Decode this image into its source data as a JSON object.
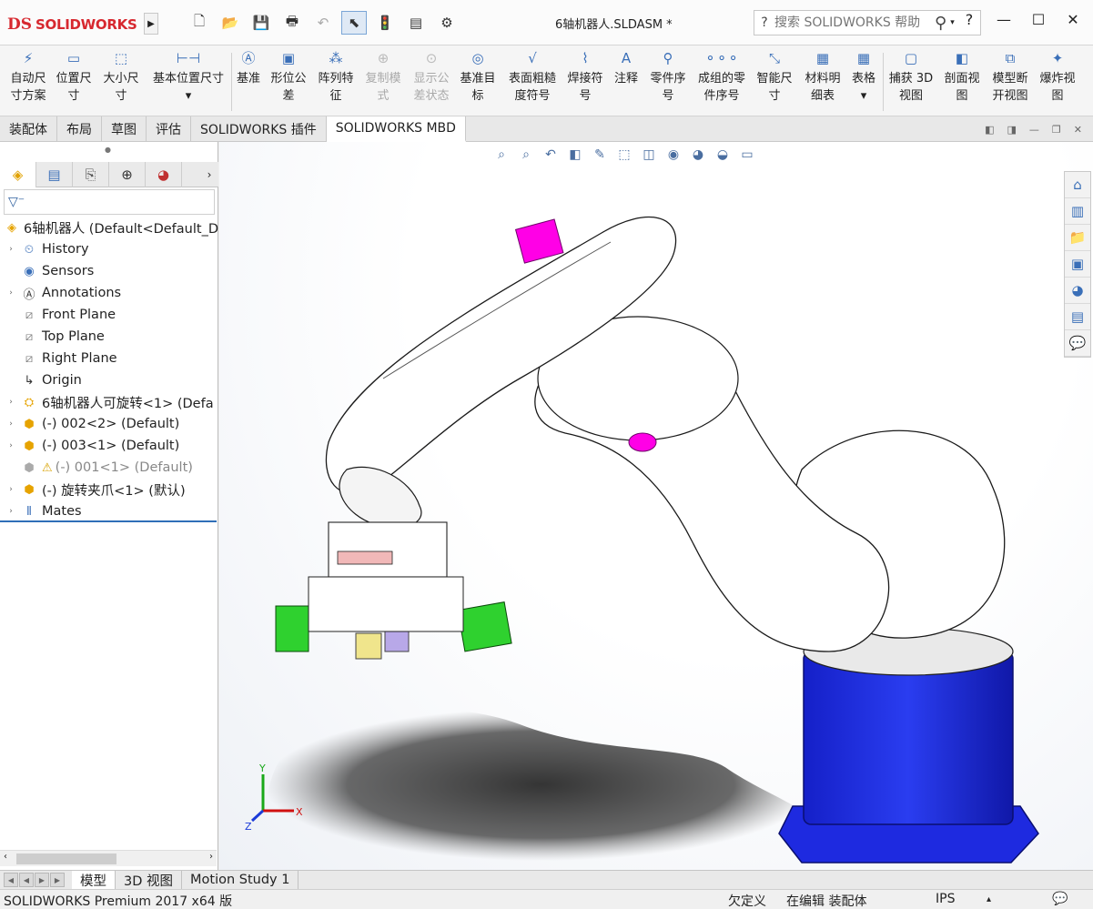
{
  "app": {
    "logo_ds": "DS",
    "logo_text": "SOLIDWORKS",
    "doc_title": "6轴机器人.SLDASM *",
    "search_placeholder": "搜索 SOLIDWORKS 帮助",
    "help_glyph": "?",
    "accent": "#d7282f"
  },
  "ribbon": {
    "buttons": [
      {
        "l1": "自动尺",
        "l2": "寸方案",
        "icon": "auto-dimension-icon"
      },
      {
        "l1": "位置尺",
        "l2": "寸",
        "icon": "location-dimension-icon"
      },
      {
        "l1": "大小尺",
        "l2": "寸",
        "icon": "size-dimension-icon"
      },
      {
        "l1": "基本位置尺寸",
        "l2": "",
        "icon": "basic-location-icon"
      },
      {
        "l1": "基准",
        "l2": "",
        "icon": "datum-icon"
      },
      {
        "l1": "形位公",
        "l2": "差",
        "icon": "gtol-icon"
      },
      {
        "l1": "阵列特",
        "l2": "征",
        "icon": "pattern-icon"
      },
      {
        "l1": "复制模",
        "l2": "式",
        "icon": "copy-scheme-icon"
      },
      {
        "l1": "显示公",
        "l2": "差状态",
        "icon": "show-tolerance-icon"
      },
      {
        "l1": "基准目",
        "l2": "标",
        "icon": "datum-target-icon"
      },
      {
        "l1": "表面粗糙",
        "l2": "度符号",
        "icon": "surface-finish-icon"
      },
      {
        "l1": "焊接符",
        "l2": "号",
        "icon": "weld-symbol-icon"
      },
      {
        "l1": "注释",
        "l2": "",
        "icon": "note-icon"
      },
      {
        "l1": "零件序",
        "l2": "号",
        "icon": "balloon-icon"
      },
      {
        "l1": "成组的零",
        "l2": "件序号",
        "icon": "stacked-balloon-icon"
      },
      {
        "l1": "智能尺",
        "l2": "寸",
        "icon": "smart-dimension-icon"
      },
      {
        "l1": "材料明",
        "l2": "细表",
        "icon": "bom-icon"
      },
      {
        "l1": "表格",
        "l2": "",
        "icon": "table-icon"
      },
      {
        "l1": "捕获 3D",
        "l2": "视图",
        "icon": "capture-3d-icon"
      },
      {
        "l1": "剖面视",
        "l2": "图",
        "icon": "section-view-icon"
      },
      {
        "l1": "模型断",
        "l2": "开视图",
        "icon": "model-break-icon"
      },
      {
        "l1": "爆炸视",
        "l2": "图",
        "icon": "explode-view-icon"
      }
    ]
  },
  "tabs": [
    {
      "label": "装配体"
    },
    {
      "label": "布局"
    },
    {
      "label": "草图"
    },
    {
      "label": "评估"
    },
    {
      "label": "SOLIDWORKS 插件"
    },
    {
      "label": "SOLIDWORKS MBD"
    }
  ],
  "tree": {
    "root": "6轴机器人  (Default<Default_D",
    "items": [
      {
        "label": "History"
      },
      {
        "label": "Sensors"
      },
      {
        "label": "Annotations"
      },
      {
        "label": "Front Plane"
      },
      {
        "label": "Top Plane"
      },
      {
        "label": "Right Plane"
      },
      {
        "label": "Origin"
      },
      {
        "label": "6轴机器人可旋转<1> (Defa"
      },
      {
        "label": "(-) 002<2> (Default)"
      },
      {
        "label": "(-) 003<1> (Default)"
      },
      {
        "label": "(-) 001<1> (Default)"
      },
      {
        "label": "(-) 旋转夹爪<1> (默认)"
      },
      {
        "label": "Mates"
      }
    ]
  },
  "bottom_tabs": [
    {
      "label": "模型"
    },
    {
      "label": "3D 视图"
    },
    {
      "label": "Motion Study 1"
    }
  ],
  "status": {
    "product": "SOLIDWORKS Premium 2017 x64 版",
    "underdefined": "欠定义",
    "editing": "在编辑 装配体",
    "units": "IPS"
  },
  "triad": {
    "x": "X",
    "y": "Y",
    "z": "Z"
  },
  "colors": {
    "base_blue": "#1d2bd6",
    "marker_magenta": "#ff00e6",
    "gripper_green": "#2fd12f"
  }
}
